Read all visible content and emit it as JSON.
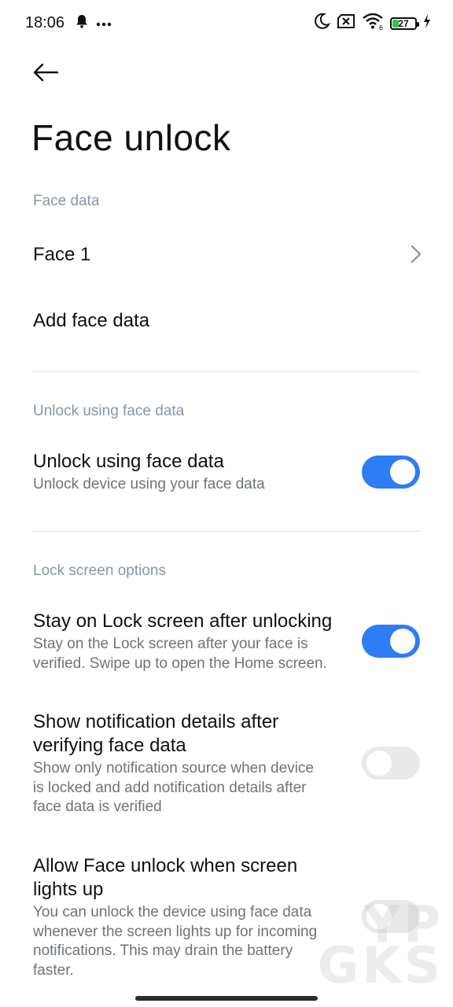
{
  "status_bar": {
    "time": "18:06",
    "battery_level": "27",
    "battery_fraction": 0.27
  },
  "header": {
    "title": "Face unlock"
  },
  "sections": {
    "face_data": {
      "header": "Face data",
      "face1_label": "Face 1",
      "add_label": "Add face data"
    },
    "unlock": {
      "header": "Unlock using face data",
      "item_title": "Unlock using face data",
      "item_sub": "Unlock device using your face data",
      "toggle_on": true
    },
    "lock_screen": {
      "header": "Lock screen options",
      "stay": {
        "title": "Stay on Lock screen after unlocking",
        "sub_lines": [
          "Stay on the Lock screen after your face is",
          "verified. Swipe up to open the Home screen."
        ],
        "toggle_on": true
      },
      "notif": {
        "title_lines": [
          "Show notification details after",
          "verifying face data"
        ],
        "sub_lines": [
          "Show only notification source when device",
          "is locked and add notification details after",
          "face data is verified"
        ],
        "toggle_on": false
      },
      "lights": {
        "title_lines": [
          "Allow Face unlock when screen",
          "lights up"
        ],
        "sub_lines": [
          "You can unlock the device using face data",
          "whenever the screen lights up for incoming",
          "notifications. This may drain the battery",
          "faster."
        ],
        "toggle_on": false
      }
    }
  },
  "watermark": {
    "line1": "YP",
    "line2": "GKS"
  },
  "colors": {
    "accent": "#2e7cf6",
    "section_header": "#8a94a7",
    "toggle_off": "#e9e9e9"
  }
}
